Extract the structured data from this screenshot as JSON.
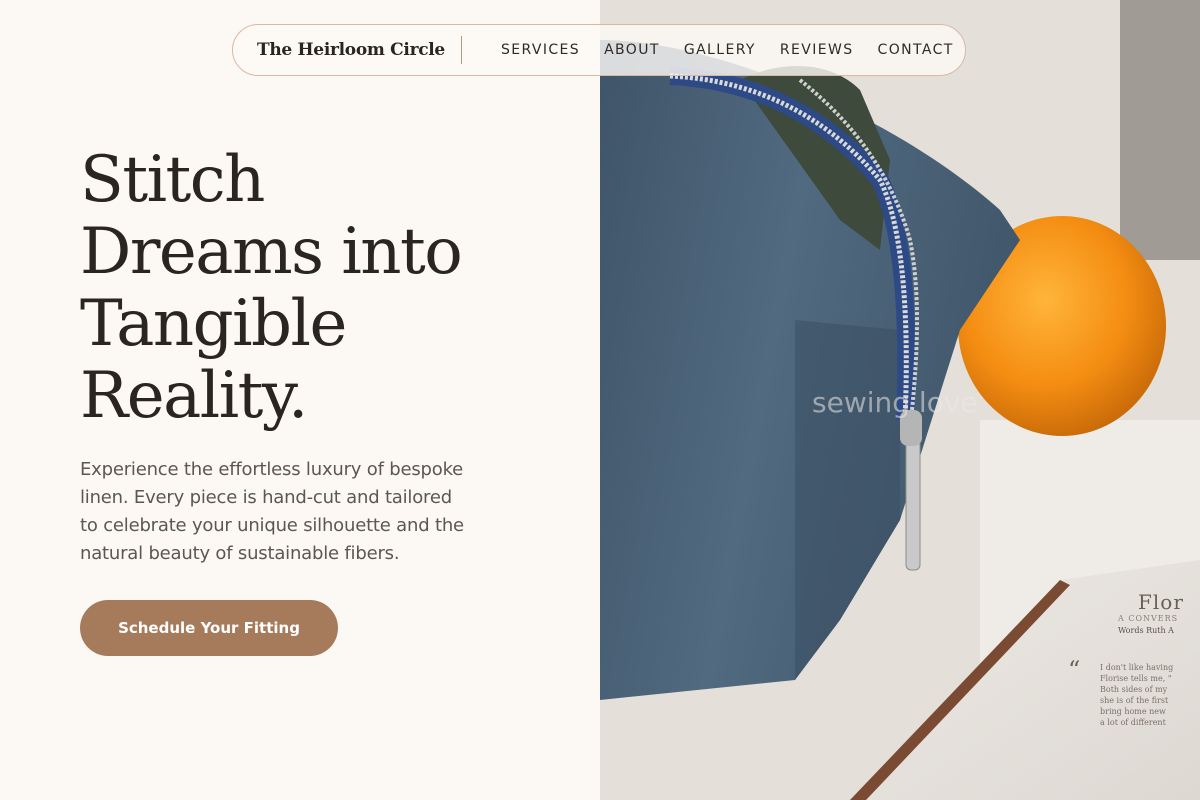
{
  "nav": {
    "brand": "The Heirloom Circle",
    "links": [
      "SERVICES",
      "ABOUT",
      "GALLERY",
      "REVIEWS",
      "CONTACT"
    ]
  },
  "hero": {
    "headline_lines": [
      "Stitch",
      "Dreams into",
      "Tangible",
      "Reality."
    ],
    "subtext_lines": [
      "Experience the effortless luxury of bespoke",
      "linen. Every piece is hand-cut and tailored",
      "to celebrate your unique silhouette and the",
      "natural beauty of sustainable fibers."
    ],
    "cta_label": "Schedule Your Fitting"
  },
  "image": {
    "watermark": "sewing love",
    "book_title": "Flor",
    "book_subtitle": "A CONVERS",
    "book_byline": "Words Ruth A",
    "book_quote_lines": [
      "I don't like having",
      "Florise tells me, \"",
      "Both sides of my",
      "she is of the first",
      "bring home new",
      "a lot of different"
    ]
  },
  "colors": {
    "background": "#fcf8f3",
    "accent": "#a67b5b",
    "text_dark": "#2a2520",
    "text_muted": "#5e5650",
    "nav_border": "#d9b8a6"
  }
}
